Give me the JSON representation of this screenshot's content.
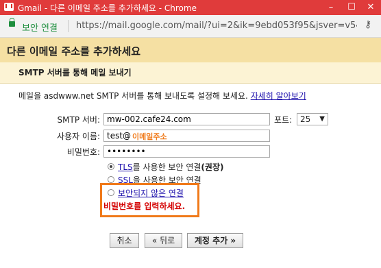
{
  "window": {
    "title": "Gmail - 다른 이메일 주소를 추가하세요 - Chrome"
  },
  "address_bar": {
    "security": "보안 연결",
    "url": "https://mail.google.com/mail/?ui=2&ik=9ebd053f95&jsver=v54..."
  },
  "dialog": {
    "heading": "다른 이메일 주소를 추가하세요",
    "subheading": "SMTP 서버를 통해 메일 보내기",
    "description": "메일을 asdwww.net SMTP 서버를 통해 보내도록 설정해 보세요.",
    "learn_more": "자세히 알아보기",
    "smtp_label": "SMTP 서버:",
    "smtp_value": "mw-002.cafe24.com",
    "port_label": "포트:",
    "port_value": "25",
    "username_label": "사용자 이름:",
    "username_value": "test@",
    "username_annotation": "이메일주소",
    "password_label": "비밀번호:",
    "password_value": "••••••••",
    "security_options": [
      {
        "link": "TLS",
        "rest": "를 사용한 보안 연결",
        "suffix": "(권장)",
        "checked": true
      },
      {
        "link": "SSL",
        "rest": "을 사용한 보안 연결",
        "suffix": "",
        "checked": false
      },
      {
        "link": "보안되지 않은 연결",
        "rest": "",
        "suffix": "",
        "checked": false
      }
    ],
    "error": "비밀번호를 입력하세요.",
    "buttons": {
      "cancel": "취소",
      "back": "« 뒤로",
      "add": "계정 추가 »"
    }
  }
}
